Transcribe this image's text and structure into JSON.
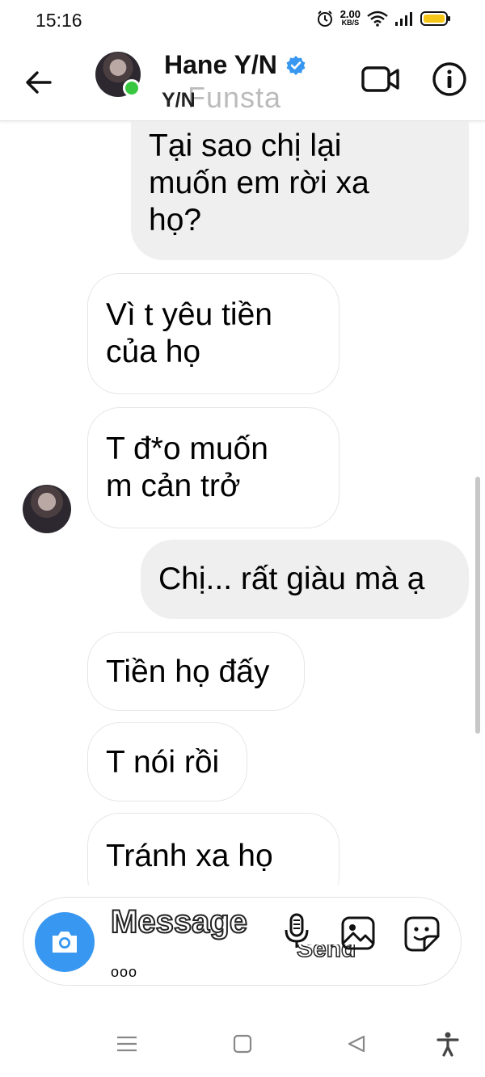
{
  "status_bar": {
    "time": "15:16",
    "net_speed": "2.00",
    "net_unit": "KB/S"
  },
  "header": {
    "contact_name": "Hane Y/N",
    "handle": "Y/N",
    "handle_overlay": "Funsta",
    "back_icon": "arrow-left-icon",
    "video_icon": "video-camera-icon",
    "info_icon": "info-icon",
    "verified_color": "#3897f0",
    "online_color": "#39c640"
  },
  "messages": [
    {
      "from": "me",
      "lines": [
        "Tại sao chị lại",
        "muốn em rời xa",
        "họ?"
      ]
    },
    {
      "from": "them",
      "lines": [
        "Vì t yêu tiền",
        "của họ"
      ]
    },
    {
      "from": "them",
      "lines": [
        "T đ*o muốn",
        "m cản trở"
      ]
    },
    {
      "from": "me",
      "lines": [
        "Chị... rất giàu mà ạ"
      ]
    },
    {
      "from": "them",
      "lines": [
        "Tiền họ đấy"
      ]
    },
    {
      "from": "them",
      "lines": [
        "T nói rồi"
      ]
    },
    {
      "from": "them",
      "lines": [
        "Tránh xa họ"
      ]
    }
  ],
  "composer": {
    "placeholder": "Message",
    "typing_indicator": "ooo",
    "send_label": "Send",
    "camera_color": "#3897f0"
  },
  "colors": {
    "sent_bubble": "#efefef",
    "received_border": "#e6e6e6"
  }
}
